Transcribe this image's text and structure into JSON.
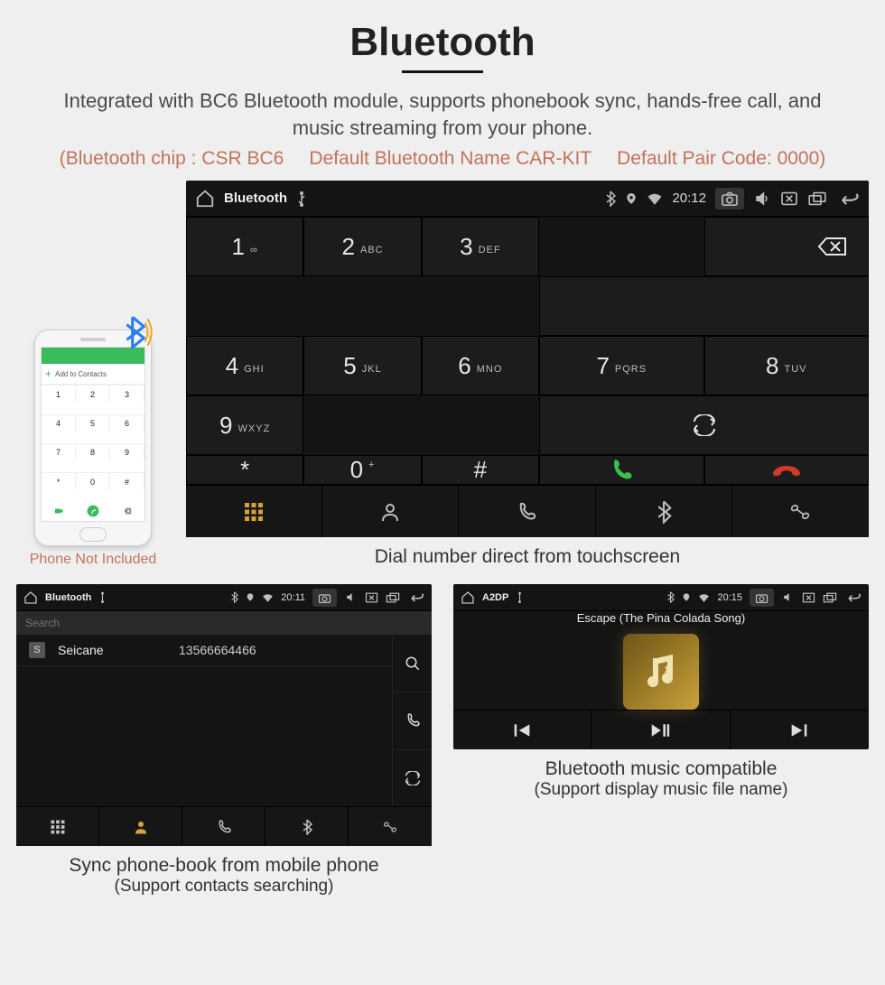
{
  "title": "Bluetooth",
  "subtitle": "Integrated with BC6 Bluetooth module, supports phonebook sync, hands-free call, and music streaming from your phone.",
  "spec": {
    "chip": "(Bluetooth chip : CSR BC6",
    "name": "Default Bluetooth Name CAR-KIT",
    "code": "Default Pair Code: 0000)"
  },
  "phone_mock": {
    "add_contacts": "Add to Contacts",
    "keys": [
      "1",
      "2",
      "3",
      "4",
      "5",
      "6",
      "7",
      "8",
      "9",
      "*",
      "0",
      "#"
    ],
    "caption": "Phone Not Included"
  },
  "dialer": {
    "status": {
      "title": "Bluetooth",
      "time": "20:12"
    },
    "keys": [
      {
        "n": "1",
        "s": "∞"
      },
      {
        "n": "2",
        "s": "ABC"
      },
      {
        "n": "3",
        "s": "DEF"
      },
      {
        "n": "4",
        "s": "GHI"
      },
      {
        "n": "5",
        "s": "JKL"
      },
      {
        "n": "6",
        "s": "MNO"
      },
      {
        "n": "7",
        "s": "PQRS"
      },
      {
        "n": "8",
        "s": "TUV"
      },
      {
        "n": "9",
        "s": "WXYZ"
      },
      {
        "n": "*",
        "s": ""
      },
      {
        "n": "0",
        "s": "+"
      },
      {
        "n": "#",
        "s": ""
      }
    ],
    "caption": "Dial number direct from touchscreen"
  },
  "phonebook": {
    "status": {
      "title": "Bluetooth",
      "time": "20:11"
    },
    "search_placeholder": "Search",
    "contact": {
      "initial": "S",
      "name": "Seicane",
      "number": "13566664466"
    },
    "caption_l1": "Sync phone-book from mobile phone",
    "caption_l2": "(Support contacts searching)"
  },
  "a2dp": {
    "status": {
      "title": "A2DP",
      "time": "20:15"
    },
    "song": "Escape (The Pina Colada Song)",
    "caption_l1": "Bluetooth music compatible",
    "caption_l2": "(Support display music file name)"
  }
}
